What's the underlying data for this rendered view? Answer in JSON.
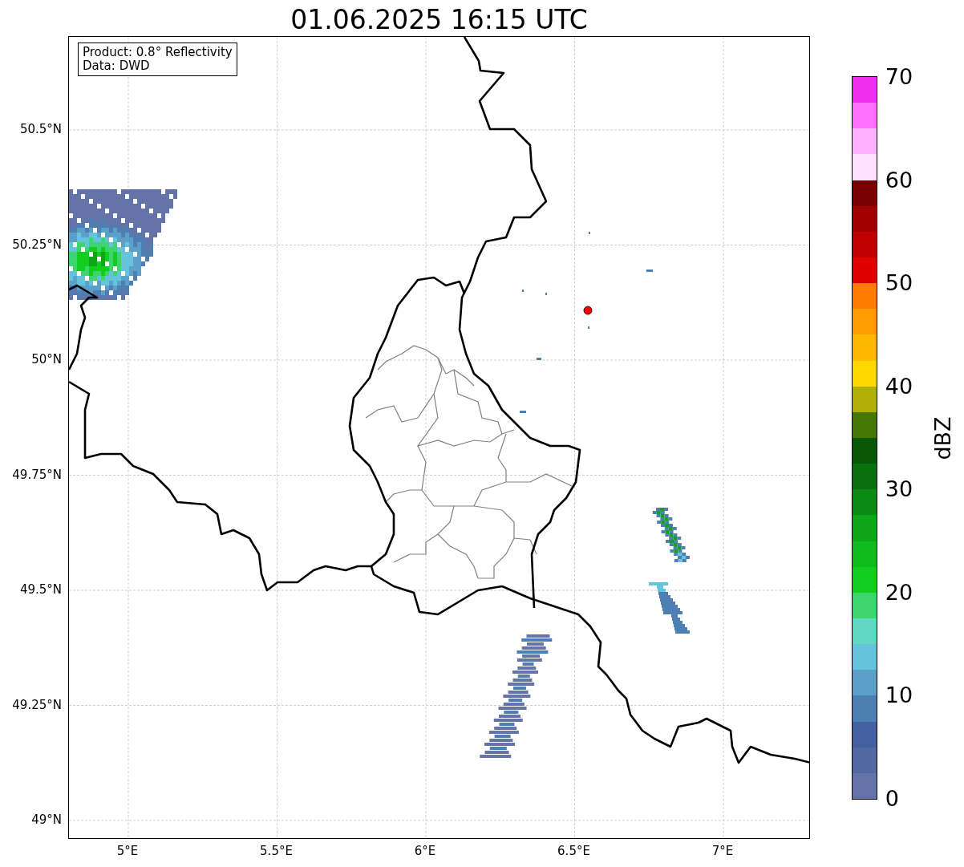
{
  "title": "01.06.2025 16:15 UTC",
  "legend": [
    "Product: 0.8° Reflectivity",
    "Data: DWD"
  ],
  "map": {
    "yticks": [
      "50.5°N",
      "50.25°N",
      "50°N",
      "49.75°N",
      "49.5°N",
      "49.25°N",
      "49°N"
    ],
    "xticks": [
      "5°E",
      "5.5°E",
      "6°E",
      "6.5°E",
      "7°E"
    ]
  },
  "colorbar": {
    "label": "dBZ",
    "ticks": [
      "70",
      "60",
      "50",
      "40",
      "30",
      "20",
      "10",
      "0"
    ],
    "bands": [
      {
        "color": "#ee30ee"
      },
      {
        "color": "#ff70ff"
      },
      {
        "color": "#ffb0ff"
      },
      {
        "color": "#ffe0ff"
      },
      {
        "color": "#780000"
      },
      {
        "color": "#a00000"
      },
      {
        "color": "#c00000"
      },
      {
        "color": "#e00000"
      },
      {
        "color": "#ff7c00"
      },
      {
        "color": "#ff9c00"
      },
      {
        "color": "#ffb800"
      },
      {
        "color": "#ffd800"
      },
      {
        "color": "#b0b008"
      },
      {
        "color": "#467808"
      },
      {
        "color": "#085808"
      },
      {
        "color": "#0a700e"
      },
      {
        "color": "#0c8a14"
      },
      {
        "color": "#0ea616"
      },
      {
        "color": "#10bc1c"
      },
      {
        "color": "#12cc1e"
      },
      {
        "color": "#3ed46e"
      },
      {
        "color": "#60d8c4"
      },
      {
        "color": "#65c4dc"
      },
      {
        "color": "#5aa0c8"
      },
      {
        "color": "#4d7fb3"
      },
      {
        "color": "#4460a0"
      },
      {
        "color": "#5268a0"
      },
      {
        "color": "#6474a8"
      }
    ]
  }
}
